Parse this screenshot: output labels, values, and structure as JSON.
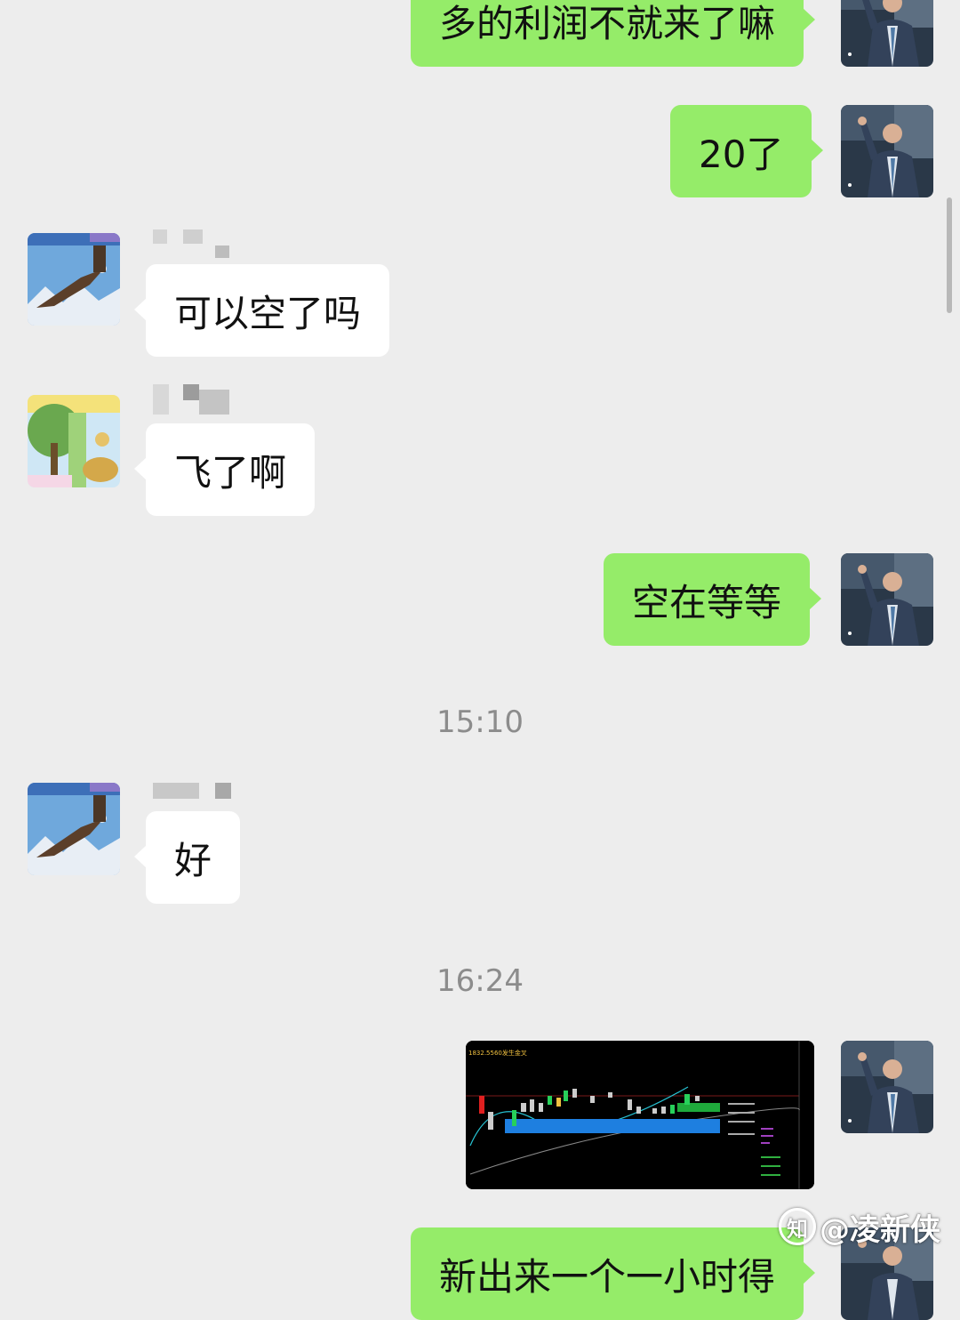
{
  "messages": [
    {
      "sender": "me",
      "text": "多的利润不就来了嘛"
    },
    {
      "sender": "me",
      "text": "20了"
    },
    {
      "sender": "other",
      "text": "可以空了吗"
    },
    {
      "sender": "other",
      "text": "飞了啊"
    },
    {
      "sender": "me",
      "text": "空在等等"
    },
    {
      "sender": "other",
      "text": "好"
    },
    {
      "sender": "me",
      "text": "新出来一个一小时得"
    }
  ],
  "timestamps": [
    "15:10",
    "16:24"
  ],
  "chart_image": {
    "header_text": "1832.5560发生金叉"
  },
  "watermark": {
    "text": "@凌新侠",
    "icon": "zhihu-logo-icon"
  },
  "colors": {
    "background": "#ededed",
    "my_bubble": "#95ec69",
    "their_bubble": "#ffffff"
  }
}
